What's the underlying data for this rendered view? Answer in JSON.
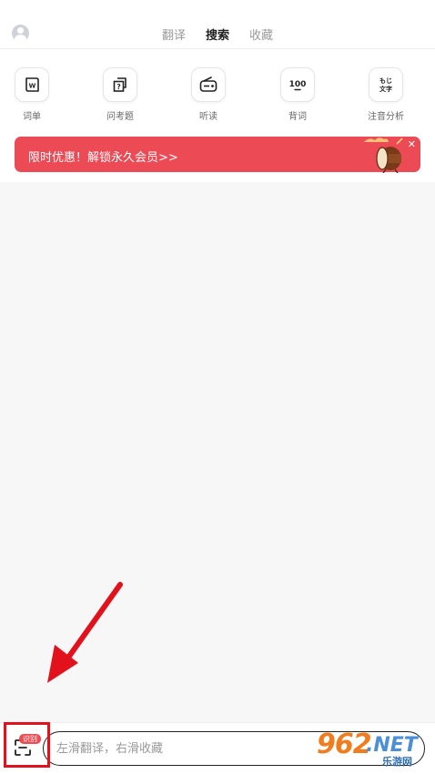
{
  "header": {
    "tabs": [
      {
        "label": "翻译",
        "active": false
      },
      {
        "label": "搜索",
        "active": true
      },
      {
        "label": "收藏",
        "active": false
      }
    ]
  },
  "quick_actions": [
    {
      "label": "词单",
      "icon": "word-list-icon"
    },
    {
      "label": "问考题",
      "icon": "exam-question-icon"
    },
    {
      "label": "听读",
      "icon": "radio-icon"
    },
    {
      "label": "背词",
      "icon": "100-icon",
      "icon_text": "100"
    },
    {
      "label": "注音分析",
      "icon": "furigana-icon",
      "icon_text_top": "もじ",
      "icon_text_bottom": "文字"
    }
  ],
  "banner": {
    "text": "限时优惠！解锁永久会员>>",
    "close_label": "✕",
    "color": "#ec4a55"
  },
  "bottom": {
    "scan_badge": "识别",
    "search_placeholder": "左滑翻译，右滑收藏"
  },
  "watermark": {
    "number": "962",
    "suffix": ".NET",
    "caption": "乐游网"
  },
  "colors": {
    "accent": "#ec4a55",
    "highlight": "#e2121c"
  }
}
